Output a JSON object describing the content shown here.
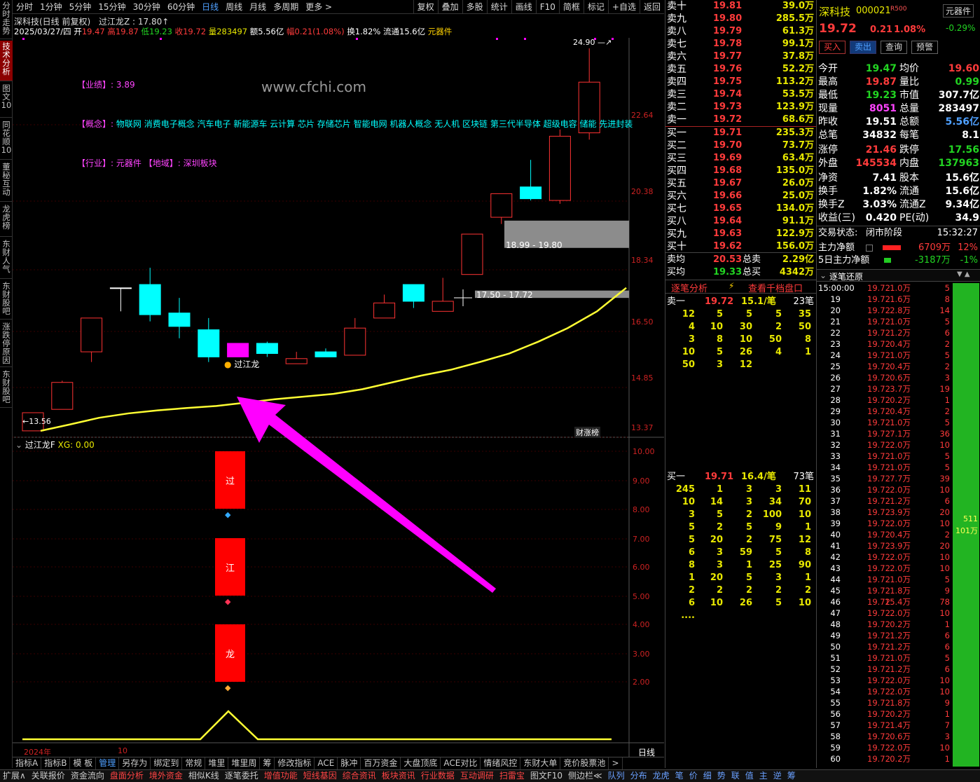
{
  "left_tabs": [
    "分时走势",
    "技术分析",
    "图文10",
    "同花顺10",
    "董秘互动",
    "龙虎榜",
    "东财人气",
    "东财股吧",
    "涨跌停原因",
    "东财股吧"
  ],
  "period_tabs": [
    "分时",
    "1分钟",
    "5分钟",
    "15分钟",
    "30分钟",
    "60分钟",
    "日线",
    "周线",
    "月线",
    "多周期",
    "更多 >"
  ],
  "tool_tabs": [
    "复权",
    "叠加",
    "多股",
    "统计",
    "画线",
    "F10",
    "简框",
    "标记",
    "+自选",
    "返回"
  ],
  "info": {
    "title": "深科技(日线 前复权)",
    "indicator": "过江龙Z : 17.80↑",
    "date": "2025/03/27/四",
    "open_l": "开",
    "open": "19.47",
    "high_l": "高",
    "high": "19.87",
    "low_l": "低",
    "low": "19.23",
    "close_l": "收",
    "close": "19.72",
    "vol_l": "量",
    "vol": "283497",
    "amt_l": "额",
    "amt": "5.56亿",
    "chg_l": "幅",
    "chg": "0.21(1.08%)",
    "turn": "换1.82%",
    "float": "流通15.6亿",
    "sector": "元器件"
  },
  "watermark": "www.cfchi.com",
  "notes": {
    "perf_label": "【业绩】:",
    "perf": "3.89",
    "concept_label": "【概念】:",
    "concept": "物联网 消费电子概念 汽车电子 新能源车 云计算 芯片 存储芯片 智能电网 机器人概念 无人机 区块链 第三代半导体 超级电容 储能 先进封装",
    "industry_label": "【行业】:",
    "industry": "元器件",
    "region_label": "【地域】:",
    "region": "深圳板块"
  },
  "price_axis": [
    "22.64",
    "20.38",
    "18.34",
    "16.50",
    "14.85",
    "13.37"
  ],
  "zone1": "18.99 - 19.80",
  "zone2": "17.50 - 17.72",
  "low_mark": "←13.56",
  "high_mark": "24.90 —↗",
  "dragon_label": "过江龙",
  "badge": "财涨榜",
  "sub": {
    "title": "过江龙F",
    "xg": "XG: 0.00",
    "axis": [
      "10.00",
      "9.00",
      "8.00",
      "7.00",
      "6.00",
      "5.00",
      "4.00",
      "3.00",
      "2.00"
    ],
    "blocks": [
      "过",
      "江",
      "龙"
    ],
    "year": "2024年",
    "month": "10"
  },
  "sub_axis_bottom": "日线",
  "bottom_tabs": [
    "指标A",
    "指标B",
    "模 板",
    "管理",
    "另存为",
    "绑定到",
    "常规",
    "堆里",
    "堆里周",
    "筹",
    "修改指标",
    "ACE",
    "脉冲",
    "百万资金",
    "大盘顶底",
    "ACE对比",
    "情绪风控",
    "东财大单",
    "竞价股票池",
    ">"
  ],
  "bottom_tabs2": [
    "扩展∧",
    "关联报价",
    "资金流向",
    "盘面分析",
    "境外资金",
    "相似K线",
    "逐笔委托",
    "增值功能",
    "短线基因",
    "综合资讯",
    "板块资讯",
    "行业数据",
    "互动调研",
    "扫雷宝",
    "图文F10",
    "侧边栏≪",
    "队列",
    "分布",
    "龙虎",
    "笔",
    "价",
    "细",
    "势",
    "联",
    "值",
    "主",
    "逆",
    "筹"
  ],
  "sells": [
    [
      "卖十",
      "19.81",
      "39.0万"
    ],
    [
      "卖九",
      "19.80",
      "285.5万"
    ],
    [
      "卖八",
      "19.79",
      "61.3万"
    ],
    [
      "卖七",
      "19.78",
      "99.1万"
    ],
    [
      "卖六",
      "19.77",
      "37.8万"
    ],
    [
      "卖五",
      "19.76",
      "52.2万"
    ],
    [
      "卖四",
      "19.75",
      "113.2万"
    ],
    [
      "卖三",
      "19.74",
      "53.5万"
    ],
    [
      "卖二",
      "19.73",
      "123.9万"
    ],
    [
      "卖一",
      "19.72",
      "68.6万"
    ]
  ],
  "buys": [
    [
      "买一",
      "19.71",
      "235.3万"
    ],
    [
      "买二",
      "19.70",
      "73.7万"
    ],
    [
      "买三",
      "19.69",
      "63.4万"
    ],
    [
      "买四",
      "19.68",
      "135.0万"
    ],
    [
      "买五",
      "19.67",
      "26.0万"
    ],
    [
      "买六",
      "19.66",
      "25.0万"
    ],
    [
      "买七",
      "19.65",
      "134.0万"
    ],
    [
      "买八",
      "19.64",
      "91.1万"
    ],
    [
      "买九",
      "19.63",
      "122.9万"
    ],
    [
      "买十",
      "19.62",
      "156.0万"
    ]
  ],
  "avg": {
    "sell_l": "卖均",
    "sell": "20.53",
    "tsell_l": "总卖",
    "tsell": "2.29亿",
    "buy_l": "买均",
    "buy": "19.33",
    "tbuy_l": "总买",
    "tbuy": "4342万"
  },
  "analysis_tab": "逐笔分析",
  "qian_tab": "查看千档盘口",
  "sell1": {
    "label": "卖一",
    "price": "19.72",
    "avg": "15.1/笔",
    "count": "23笔",
    "rows": [
      [
        "12",
        "5",
        "5",
        "5",
        "35"
      ],
      [
        "4",
        "10",
        "30",
        "2",
        "50"
      ],
      [
        "3",
        "8",
        "10",
        "50",
        "8"
      ],
      [
        "10",
        "5",
        "26",
        "4",
        "1"
      ],
      [
        "50",
        "3",
        "12",
        "",
        ""
      ]
    ]
  },
  "buy1": {
    "label": "买一",
    "price": "19.71",
    "avg": "16.4/笔",
    "count": "73笔",
    "rows": [
      [
        "245",
        "1",
        "3",
        "3",
        "11"
      ],
      [
        "10",
        "14",
        "3",
        "34",
        "70"
      ],
      [
        "3",
        "5",
        "2",
        "100",
        "10"
      ],
      [
        "5",
        "2",
        "5",
        "9",
        "1"
      ],
      [
        "5",
        "20",
        "2",
        "75",
        "12"
      ],
      [
        "6",
        "3",
        "59",
        "5",
        "8"
      ],
      [
        "8",
        "3",
        "1",
        "25",
        "90"
      ],
      [
        "1",
        "20",
        "5",
        "3",
        "1"
      ],
      [
        "2",
        "2",
        "2",
        "2",
        "2"
      ],
      [
        "6",
        "10",
        "26",
        "5",
        "10"
      ],
      [
        "....",
        "",
        "",
        "",
        ""
      ]
    ]
  },
  "stock": {
    "name": "深科技",
    "code": "000021",
    "tag": "R500",
    "sector": "元器件",
    "sector_chg": "-0.29%",
    "price": "19.72",
    "chg": "0.21",
    "pct": "1.08%"
  },
  "actions": [
    "买入",
    "卖出",
    "查询",
    "预警"
  ],
  "stats": [
    [
      "今开",
      "19.47",
      "均价",
      "19.60"
    ],
    [
      "最高",
      "19.87",
      "量比",
      "0.99"
    ],
    [
      "最低",
      "19.23",
      "市值",
      "307.7亿"
    ],
    [
      "现量",
      "8051",
      "总量",
      "283497"
    ],
    [
      "昨收",
      "19.51",
      "总额",
      "5.56亿"
    ],
    [
      "总笔",
      "34832",
      "每笔",
      "8.1"
    ]
  ],
  "stats2": [
    [
      "涨停",
      "21.46",
      "跌停",
      "17.56"
    ],
    [
      "外盘",
      "145534",
      "内盘",
      "137963"
    ]
  ],
  "stats3": [
    [
      "净资",
      "7.41",
      "股本",
      "15.6亿"
    ],
    [
      "换手",
      "1.82%",
      "流通",
      "15.6亿"
    ],
    [
      "换手Z",
      "3.03%",
      "流通Z",
      "9.34亿"
    ],
    [
      "收益(三)",
      "0.420",
      "PE(动)",
      "34.9"
    ]
  ],
  "trade_status": {
    "label": "交易状态:",
    "value": "闭市阶段",
    "time": "15:32:27"
  },
  "main_net": {
    "label": "主力净额",
    "value": "6709万",
    "pct": "12%"
  },
  "net5": {
    "label": "5日主力净额",
    "value": "-3187万",
    "pct": "-1%"
  },
  "ticks_title": "逐笔还原",
  "ticks": [
    [
      "15:00:00",
      "19.72",
      "1.0万",
      "5"
    ],
    [
      "19",
      "19.72",
      "1.6万",
      "8"
    ],
    [
      "20",
      "19.72",
      "2.8万",
      "14"
    ],
    [
      "21",
      "19.72",
      "1.0万",
      "5"
    ],
    [
      "22",
      "19.72",
      "1.2万",
      "6"
    ],
    [
      "23",
      "19.72",
      "0.4万",
      "2"
    ],
    [
      "24",
      "19.72",
      "1.0万",
      "5"
    ],
    [
      "25",
      "19.72",
      "0.4万",
      "2"
    ],
    [
      "26",
      "19.72",
      "0.6万",
      "3"
    ],
    [
      "27",
      "19.72",
      "3.7万",
      "19"
    ],
    [
      "28",
      "19.72",
      "0.2万",
      "1"
    ],
    [
      "29",
      "19.72",
      "0.4万",
      "2"
    ],
    [
      "30",
      "19.72",
      "1.0万",
      "5"
    ],
    [
      "31",
      "19.72",
      "7.1万",
      "36"
    ],
    [
      "32",
      "19.72",
      "2.0万",
      "10"
    ],
    [
      "33",
      "19.72",
      "1.0万",
      "5"
    ],
    [
      "34",
      "19.72",
      "1.0万",
      "5"
    ],
    [
      "35",
      "19.72",
      "7.7万",
      "39"
    ],
    [
      "36",
      "19.72",
      "2.0万",
      "10"
    ],
    [
      "37",
      "19.72",
      "1.2万",
      "6"
    ],
    [
      "38",
      "19.72",
      "3.9万",
      "20"
    ],
    [
      "39",
      "19.72",
      "2.0万",
      "10"
    ],
    [
      "40",
      "19.72",
      "0.4万",
      "2"
    ],
    [
      "41",
      "19.72",
      "3.9万",
      "20"
    ],
    [
      "42",
      "19.72",
      "2.0万",
      "10"
    ],
    [
      "43",
      "19.72",
      "2.0万",
      "10"
    ],
    [
      "44",
      "19.72",
      "1.0万",
      "5"
    ],
    [
      "45",
      "19.72",
      "1.8万",
      "9"
    ],
    [
      "46",
      "19.72",
      "15.4万",
      "78"
    ],
    [
      "47",
      "19.72",
      "2.0万",
      "10"
    ],
    [
      "48",
      "19.72",
      "0.2万",
      "1"
    ],
    [
      "49",
      "19.72",
      "1.2万",
      "6"
    ],
    [
      "50",
      "19.72",
      "1.2万",
      "6"
    ],
    [
      "51",
      "19.72",
      "1.0万",
      "5"
    ],
    [
      "52",
      "19.72",
      "1.2万",
      "6"
    ],
    [
      "53",
      "19.72",
      "2.0万",
      "10"
    ],
    [
      "54",
      "19.72",
      "2.0万",
      "10"
    ],
    [
      "55",
      "19.72",
      "1.8万",
      "9"
    ],
    [
      "56",
      "19.72",
      "0.2万",
      "1"
    ],
    [
      "57",
      "19.72",
      "1.4万",
      "7"
    ],
    [
      "58",
      "19.72",
      "0.6万",
      "3"
    ],
    [
      "59",
      "19.72",
      "2.0万",
      "10"
    ],
    [
      "60",
      "19.72",
      "0.2万",
      "1"
    ]
  ],
  "big_bar": {
    "count": "511",
    "vol": "101万"
  },
  "candles": [
    {
      "o": 13.56,
      "c": 14.1,
      "h": 14.1,
      "l": 13.56,
      "col": "red"
    },
    {
      "o": 14.2,
      "c": 15.0,
      "h": 15.05,
      "l": 14.2,
      "col": "red"
    },
    {
      "o": 15.9,
      "c": 16.9,
      "h": 16.9,
      "l": 15.6,
      "col": "red"
    },
    {
      "o": 17.8,
      "c": 17.8,
      "h": 17.8,
      "l": 17.1,
      "col": "white"
    },
    {
      "o": 17.9,
      "c": 17.0,
      "h": 18.4,
      "l": 16.8,
      "col": "cyan"
    },
    {
      "o": 17.05,
      "c": 16.65,
      "h": 17.5,
      "l": 16.3,
      "col": "cyan"
    },
    {
      "o": 16.55,
      "c": 15.75,
      "h": 16.9,
      "l": 15.6,
      "col": "cyan"
    },
    {
      "o": 16.15,
      "c": 15.75,
      "h": 16.15,
      "l": 15.75,
      "col": "mag"
    },
    {
      "o": 16.15,
      "c": 15.85,
      "h": 16.2,
      "l": 15.75,
      "col": "cyan"
    },
    {
      "o": 15.55,
      "c": 15.7,
      "h": 15.9,
      "l": 15.55,
      "col": "red"
    },
    {
      "o": 15.9,
      "c": 15.75,
      "h": 16.0,
      "l": 15.75,
      "col": "cyan"
    },
    {
      "o": 15.8,
      "c": 16.6,
      "h": 16.9,
      "l": 15.8,
      "col": "red"
    },
    {
      "o": 16.9,
      "c": 17.35,
      "h": 17.6,
      "l": 16.9,
      "col": "red"
    },
    {
      "o": 17.9,
      "c": 17.4,
      "h": 17.9,
      "l": 17.2,
      "col": "cyan"
    },
    {
      "o": 17.1,
      "c": 17.4,
      "h": 18.1,
      "l": 17.1,
      "col": "red"
    },
    {
      "o": 18.2,
      "c": 19.4,
      "h": 19.4,
      "l": 18.2,
      "col": "red"
    },
    {
      "o": 19.9,
      "c": 20.6,
      "h": 20.6,
      "l": 19.7,
      "col": "red"
    },
    {
      "o": 20.8,
      "c": 20.45,
      "h": 21.6,
      "l": 20.4,
      "col": "cyan"
    },
    {
      "o": 20.4,
      "c": 22.3,
      "h": 22.5,
      "l": 20.3,
      "col": "red"
    },
    {
      "o": 22.4,
      "c": 23.9,
      "h": 24.9,
      "l": 22.2,
      "col": "red"
    }
  ],
  "ma": [
    13.56,
    13.75,
    13.95,
    14.08,
    14.17,
    14.24,
    14.3,
    14.4,
    14.5,
    14.58,
    14.66,
    14.8,
    15.0,
    15.2,
    15.37,
    15.6,
    15.85,
    16.2,
    16.6,
    17.1,
    17.8
  ],
  "sub_line": [
    1.5,
    1.5,
    1.5,
    1.5,
    1.5,
    1.5,
    1.5,
    1.5,
    2.5,
    1.5,
    1.5,
    1.5,
    1.5,
    1.5,
    1.5,
    1.5,
    1.5,
    1.5,
    1.5,
    1.5,
    1.5,
    1.5
  ],
  "colors": {
    "up": "#ff3333",
    "down": "#00ffff",
    "ma": "#ffff33",
    "arrow": "#ff00ff",
    "zone": "#8c8c8c"
  }
}
